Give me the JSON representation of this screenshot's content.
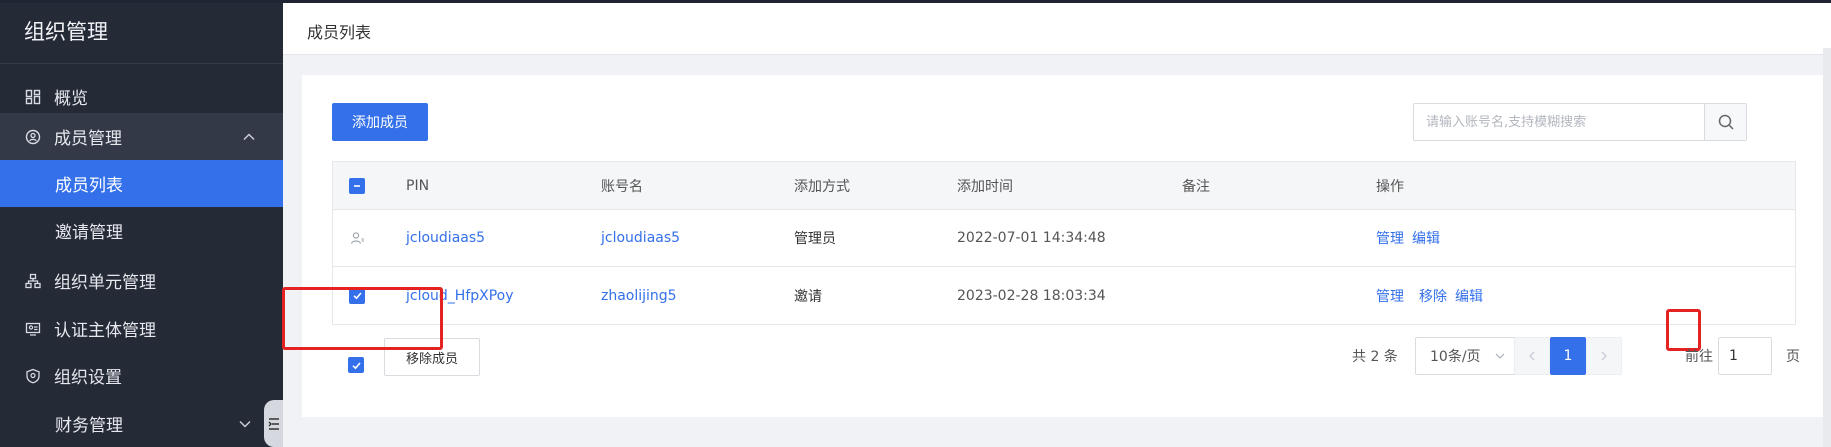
{
  "sidebar": {
    "title": "组织管理",
    "items": [
      {
        "label": "概览",
        "icon": "dashboard-icon"
      },
      {
        "label": "成员管理",
        "icon": "member-icon",
        "expanded": true
      },
      {
        "label": "成员列表",
        "active": true
      },
      {
        "label": "邀请管理"
      },
      {
        "label": "组织单元管理",
        "icon": "org-unit-icon"
      },
      {
        "label": "认证主体管理",
        "icon": "certification-icon"
      },
      {
        "label": "组织设置",
        "icon": "shield-icon"
      },
      {
        "label": "财务管理"
      }
    ]
  },
  "header": {
    "title": "成员列表"
  },
  "toolbar": {
    "add_label": "添加成员",
    "search_placeholder": "请输入账号名,支持模糊搜索"
  },
  "table": {
    "columns": [
      "PIN",
      "账号名",
      "添加方式",
      "添加时间",
      "备注",
      "操作"
    ],
    "rows": [
      {
        "pin": "jcloudiaas5",
        "account": "jcloudiaas5",
        "method": "管理员",
        "time": "2022-07-01 14:34:48",
        "note": "",
        "actions": [
          "管理",
          "编辑"
        ],
        "checked": false,
        "admin": true
      },
      {
        "pin": "jcloud_HfpXPoy",
        "account": "zhaolijing5",
        "method": "邀请",
        "time": "2023-02-28 18:03:34",
        "note": "",
        "actions": [
          "管理",
          "移除",
          "编辑"
        ],
        "checked": true,
        "admin": false
      }
    ]
  },
  "footer": {
    "remove_label": "移除成员",
    "total": "共 2 条",
    "page_size": "10条/页",
    "current_page": "1",
    "goto_prefix": "前往",
    "goto_value": "1",
    "goto_suffix": "页"
  },
  "colors": {
    "accent": "#3370ea",
    "sidebar": "#252a37",
    "highlight": "#e52222"
  }
}
